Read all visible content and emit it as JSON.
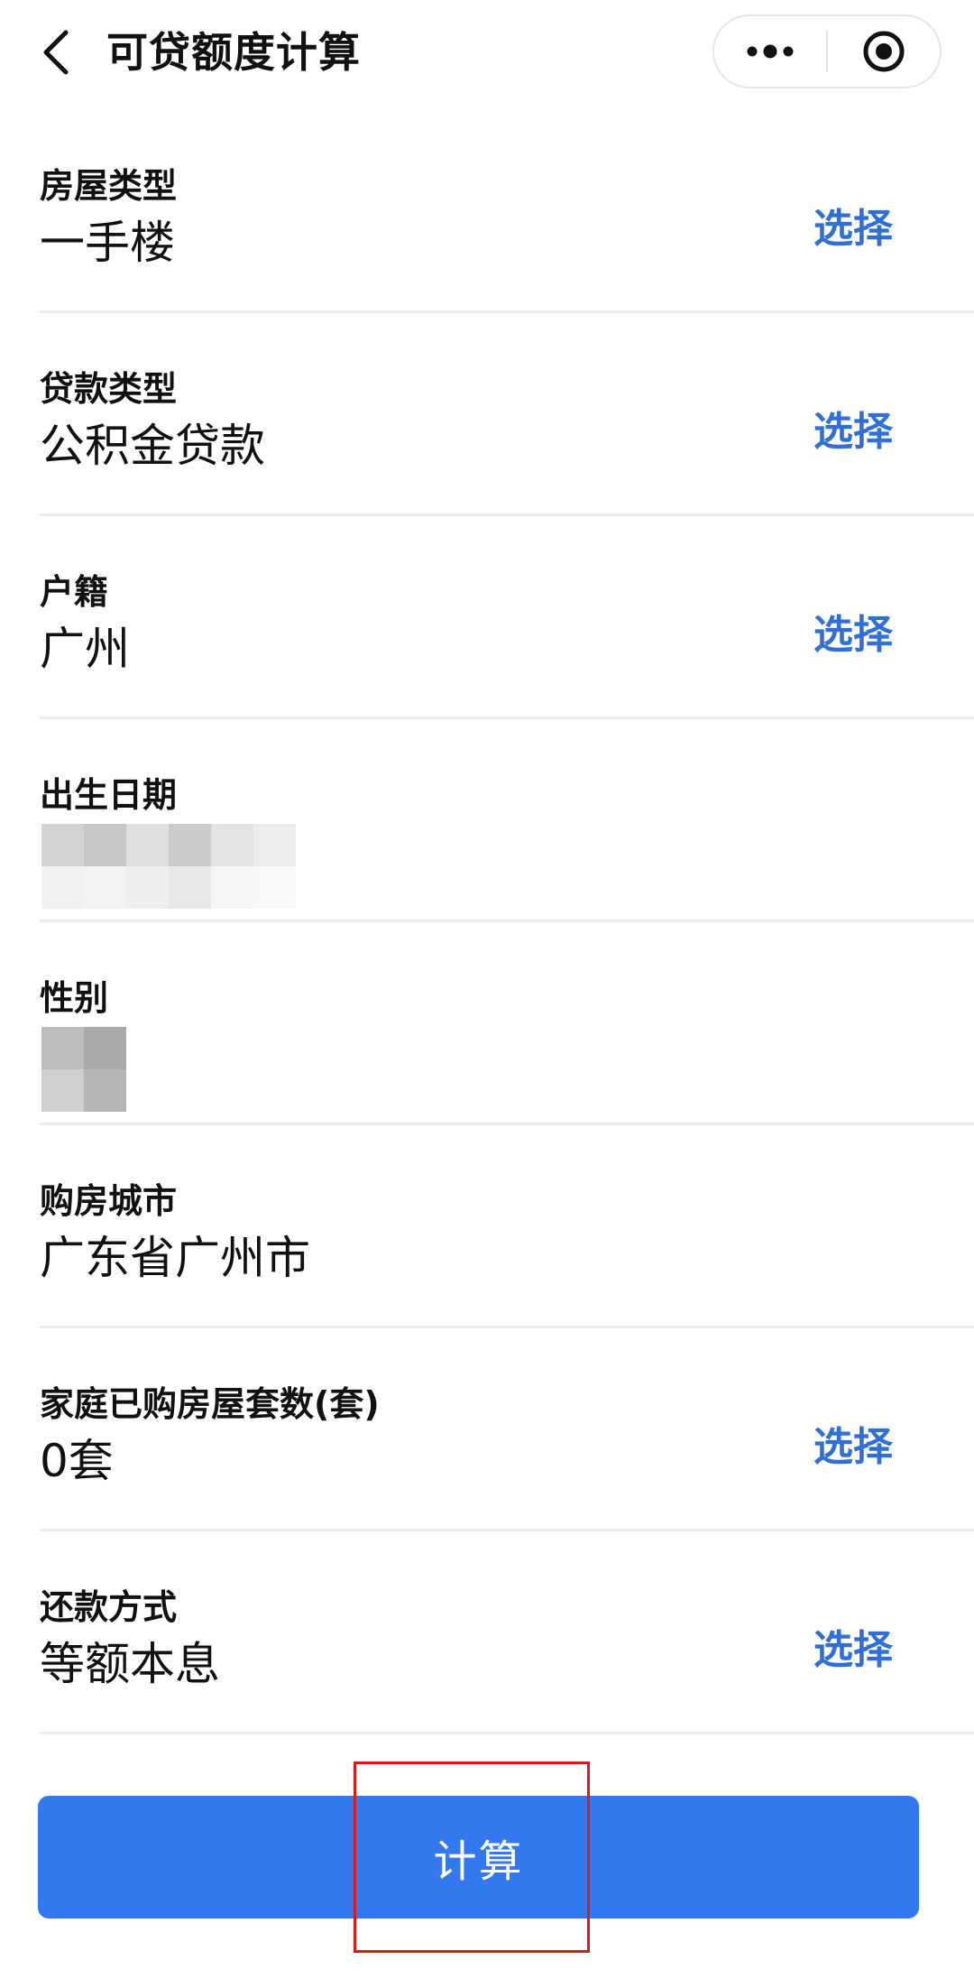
{
  "header": {
    "title": "可贷额度计算",
    "back_icon": "chevron-left-icon",
    "more_icon": "more-dots-icon",
    "close_icon": "target-circle-icon"
  },
  "form": {
    "rows": [
      {
        "label": "房屋类型",
        "value": "一手楼",
        "action": "选择"
      },
      {
        "label": "贷款类型",
        "value": "公积金贷款",
        "action": "选择"
      },
      {
        "label": "户籍",
        "value": "广州",
        "action": "选择"
      },
      {
        "label": "出生日期",
        "value": "",
        "action": ""
      },
      {
        "label": "性别",
        "value": "",
        "action": ""
      },
      {
        "label": "购房城市",
        "value": "广东省广州市",
        "action": ""
      },
      {
        "label": "家庭已购房屋套数(套)",
        "value": "0套",
        "action": "选择"
      },
      {
        "label": "还款方式",
        "value": "等额本息",
        "action": "选择"
      }
    ]
  },
  "footer": {
    "calculate_label": "计算"
  },
  "colors": {
    "accent": "#2f6fd6",
    "button": "#3478f0",
    "highlight": "#d81c1c"
  }
}
